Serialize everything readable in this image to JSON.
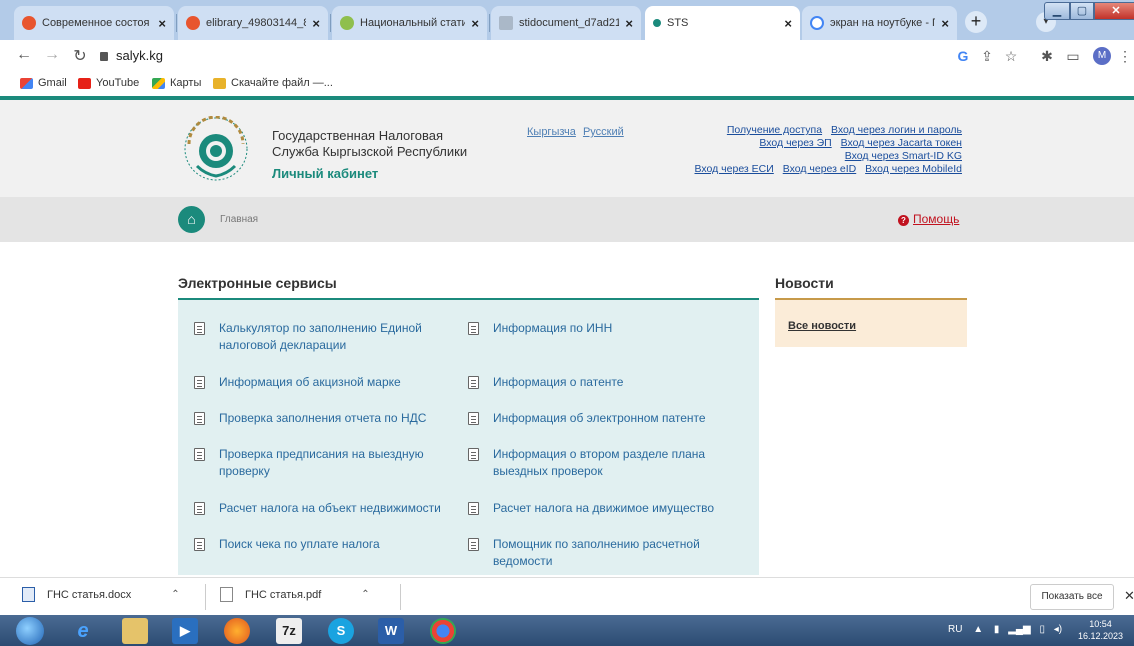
{
  "browser": {
    "tabs": [
      {
        "title": "Современное состоя",
        "favicon_color": "#e8552e"
      },
      {
        "title": "elibrary_49803144_866",
        "favicon_color": "#e8552e"
      },
      {
        "title": "Национальный статис",
        "favicon_color": "#8fbf4d"
      },
      {
        "title": "stidocument_d7ad213",
        "favicon_color": "#aab8c8"
      },
      {
        "title": "STS",
        "favicon_color": "#1b8a7c"
      },
      {
        "title": "экран на ноутбуке - П",
        "favicon_color": "#4285f4"
      }
    ],
    "active_tab_index": 4,
    "new_tab_label": "+",
    "url": "salyk.kg",
    "profile_initial": "M",
    "bookmarks": [
      "Gmail",
      "YouTube",
      "Карты",
      "Скачайте файл —..."
    ]
  },
  "site": {
    "org_name": "Государственная Налоговая Служба Кыргызской Республики",
    "cabinet": "Личный кабинет",
    "languages": [
      "Кыргызча",
      "Русский"
    ],
    "auth_links": [
      "Получение доступа",
      "Вход через логин и пароль",
      "Вход через ЭП",
      "Вход через Jacarta токен",
      "Вход через Smart-ID KG",
      "Вход через ЕСИ",
      "Вход через eID",
      "Вход через MobileId"
    ],
    "breadcrumb": "Главная",
    "help": "Помощь"
  },
  "services": {
    "title": "Электронные сервисы",
    "left": [
      "Калькулятор по заполнению Единой налоговой декларации",
      "Информация об акцизной марке",
      "Проверка заполнения отчета по НДС",
      "Проверка предписания на выездную проверку",
      "Расчет налога на объект недвижимости",
      "Поиск чека по уплате налога"
    ],
    "right": [
      "Информация по ИНН",
      "Информация о патенте",
      "Информация об электронном патенте",
      "Информация о втором разделе плана выездных проверок",
      "Расчет налога на движимое имущество",
      "Помощник по заполнению расчетной ведомости"
    ]
  },
  "news": {
    "title": "Новости",
    "all_link": "Все новости"
  },
  "downloads": {
    "items": [
      "ГНС статья.docx",
      "ГНС статья.pdf"
    ],
    "show_all": "Показать все"
  },
  "taskbar": {
    "lang": "RU",
    "time": "10:54",
    "date": "16.12.2023"
  },
  "colors": {
    "accent_teal": "#1b8a7c",
    "link_blue": "#2a6a9e",
    "help_red": "#c1121f",
    "news_panel": "#fbecd8",
    "services_panel": "#e1f0f1"
  }
}
